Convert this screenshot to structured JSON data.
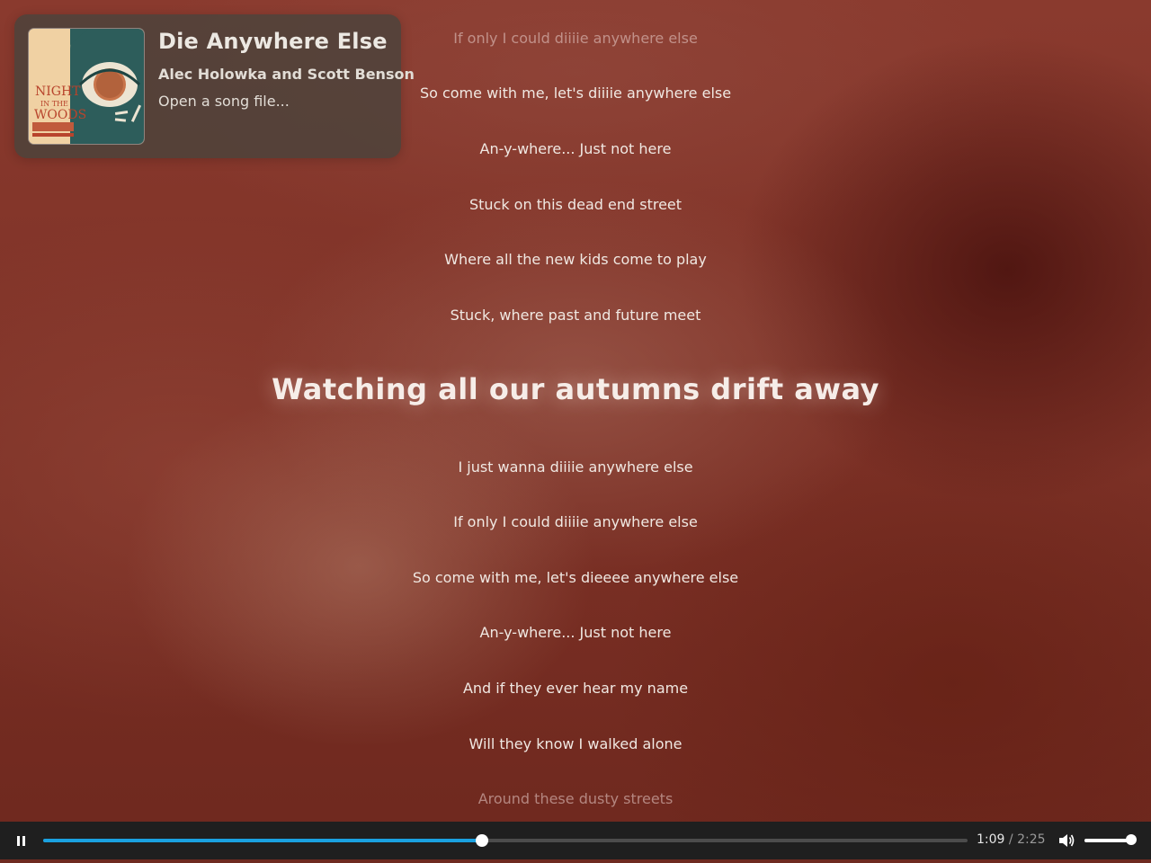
{
  "song": {
    "title": "Die Anywhere Else",
    "artist": "Alec Holowka and Scott Benson",
    "open_file_label": "Open a song file...",
    "cover_icon": "night-in-the-woods-album-cover"
  },
  "lyrics": {
    "current_index": 6,
    "lines": [
      "If only I could diiiie anywhere else",
      "So come with me, let's diiiie anywhere else",
      "An-y-where... Just not here",
      "Stuck on this dead end street",
      "Where all the new kids come to play",
      "Stuck, where past and future meet",
      "Watching all our autumns drift away",
      "I just wanna diiiie anywhere else",
      "If only I could diiiie anywhere else",
      "So come with me, let's dieeee anywhere else",
      "An-y-where... Just not here",
      "And if they ever hear my name",
      "Will they know I walked alone",
      "Around these dusty streets"
    ]
  },
  "player": {
    "state": "playing",
    "current_time": "1:09",
    "separator": "/",
    "duration": "2:25",
    "progress": 0.475,
    "volume": 1.0,
    "accent_color": "#1aa1e0",
    "pause_icon": "pause-icon",
    "volume_icon": "speaker-icon"
  }
}
